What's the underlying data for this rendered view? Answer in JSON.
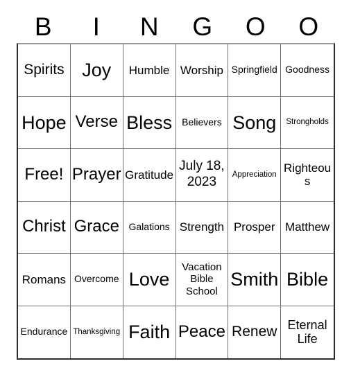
{
  "card": {
    "title_letters": [
      "B",
      "I",
      "N",
      "G",
      "O",
      "O"
    ],
    "columns": 6,
    "rows": 6,
    "border_color": "#2b2b2b",
    "grid_line_color": "#6e6e6e",
    "background_color": "#ffffff",
    "text_color": "#000000"
  },
  "grid": [
    [
      {
        "text": "Spirits",
        "size": "lg"
      },
      {
        "text": "Joy",
        "size": "xxl"
      },
      {
        "text": "Humble",
        "size": "md"
      },
      {
        "text": "Worship",
        "size": "md"
      },
      {
        "text": "Springfield",
        "size": "sm"
      },
      {
        "text": "Goodness",
        "size": "sm"
      }
    ],
    [
      {
        "text": "Hope",
        "size": "xxl"
      },
      {
        "text": "Verse",
        "size": "xl"
      },
      {
        "text": "Bless",
        "size": "xxl"
      },
      {
        "text": "Believers",
        "size": "sm"
      },
      {
        "text": "Song",
        "size": "xxl"
      },
      {
        "text": "Strongholds",
        "size": "xs"
      }
    ],
    [
      {
        "text": "Free!",
        "size": "xl"
      },
      {
        "text": "Prayer",
        "size": "xl"
      },
      {
        "text": "Gratitude",
        "size": "md"
      },
      {
        "text": "July 18, 2023",
        "size": "date"
      },
      {
        "text": "Appreciation",
        "size": "xs"
      },
      {
        "text": "Righteous",
        "size": "md"
      }
    ],
    [
      {
        "text": "Christ",
        "size": "xl"
      },
      {
        "text": "Grace",
        "size": "xl"
      },
      {
        "text": "Galations",
        "size": "sm"
      },
      {
        "text": "Strength",
        "size": "md"
      },
      {
        "text": "Prosper",
        "size": "md"
      },
      {
        "text": "Matthew",
        "size": "md"
      }
    ],
    [
      {
        "text": "Romans",
        "size": "md"
      },
      {
        "text": "Overcome",
        "size": "sm"
      },
      {
        "text": "Love",
        "size": "xxl"
      },
      {
        "text": "Vacation Bible School",
        "size": "wrap3"
      },
      {
        "text": "Smith",
        "size": "xxl"
      },
      {
        "text": "Bible",
        "size": "xxl"
      }
    ],
    [
      {
        "text": "Endurance",
        "size": "sm"
      },
      {
        "text": "Thanksgiving",
        "size": "xs"
      },
      {
        "text": "Faith",
        "size": "xxl"
      },
      {
        "text": "Peace",
        "size": "xl"
      },
      {
        "text": "Renew",
        "size": "lg"
      },
      {
        "text": "Eternal Life",
        "size": "wrap2"
      }
    ]
  ]
}
